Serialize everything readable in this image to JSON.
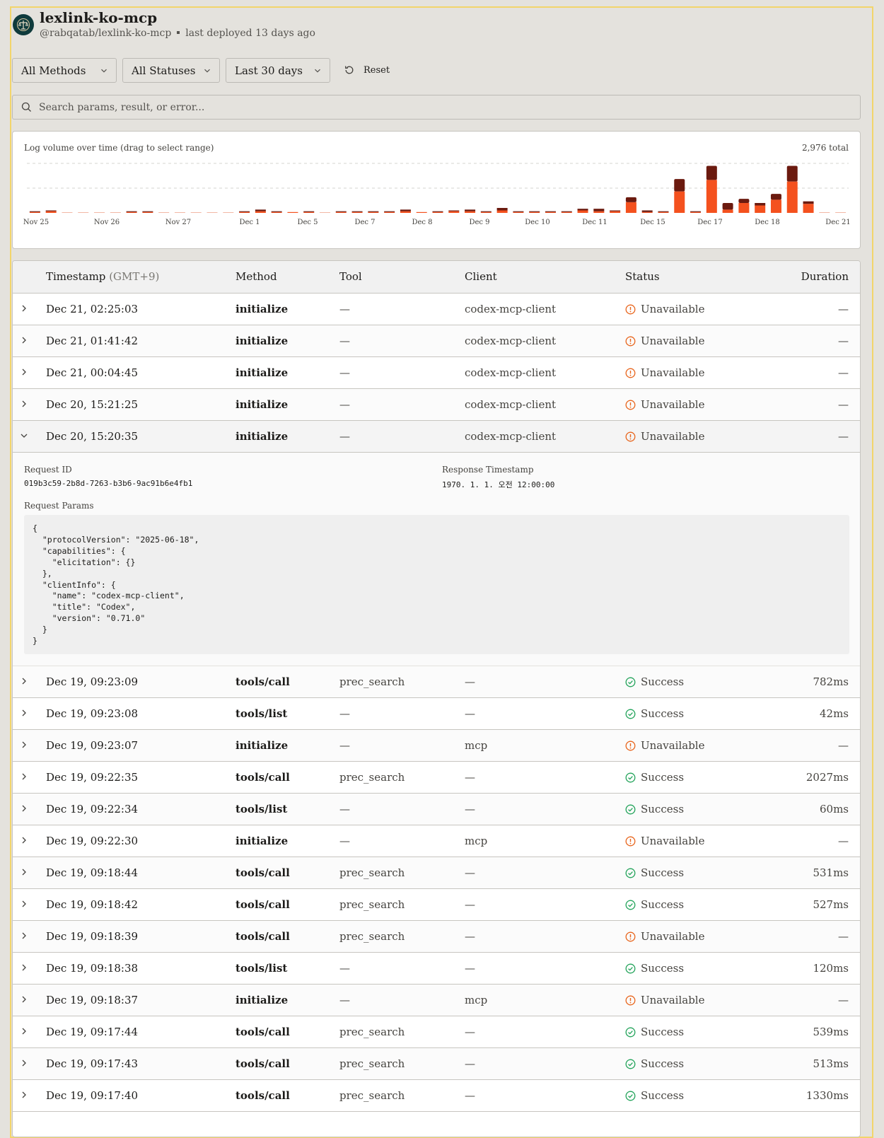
{
  "header": {
    "title": "lexlink-ko-mcp",
    "handle": "@rabqatab/lexlink-ko-mcp",
    "deployed": "last deployed 13 days ago"
  },
  "filters": {
    "methods": "All Methods",
    "statuses": "All Statuses",
    "range": "Last 30 days",
    "reset": "Reset"
  },
  "search": {
    "placeholder": "Search params, result, or error..."
  },
  "colors": {
    "success": "#22a35a",
    "warning": "#e8641b",
    "bar_primary": "#f4511e",
    "bar_dark": "#6b1a0f"
  },
  "chart": {
    "title": "Log volume over time (drag to select range)",
    "total": "2,976 total"
  },
  "chart_data": {
    "type": "bar",
    "stacked": true,
    "x_labels": [
      "Nov 25",
      "Nov 26",
      "Nov 27",
      "Dec 1",
      "Dec 5",
      "Dec 7",
      "Dec 8",
      "Dec 9",
      "Dec 10",
      "Dec 11",
      "Dec 15",
      "Dec 17",
      "Dec 18",
      "Dec 21"
    ],
    "series": [
      {
        "values": [
          1,
          2,
          0,
          0,
          0,
          0,
          1,
          1,
          0,
          0,
          0,
          0,
          0,
          1,
          2,
          1,
          1,
          1,
          0,
          1,
          1,
          1,
          1,
          2,
          1,
          1,
          2,
          2,
          1,
          3,
          1,
          1,
          1,
          1,
          3,
          2,
          2,
          13,
          1,
          1,
          26,
          1,
          40,
          4,
          12,
          9,
          16,
          38,
          11,
          0,
          0
        ]
      },
      {
        "values": [
          1,
          1,
          0,
          0,
          0,
          0,
          1,
          1,
          0,
          0,
          0,
          0,
          0,
          1,
          2,
          1,
          0,
          1,
          0,
          1,
          1,
          1,
          1,
          2,
          0,
          1,
          1,
          2,
          1,
          3,
          1,
          1,
          1,
          1,
          2,
          3,
          1,
          6,
          2,
          1,
          15,
          1,
          17,
          8,
          5,
          3,
          7,
          19,
          3,
          0,
          0
        ]
      }
    ],
    "ylim": [
      0,
      60
    ],
    "grid": true
  },
  "table": {
    "headers": {
      "timestamp": "Timestamp",
      "timezone": "(GMT+9)",
      "method": "Method",
      "tool": "Tool",
      "client": "Client",
      "status": "Status",
      "duration": "Duration"
    },
    "rows_top": [
      {
        "ts": "Dec 21, 02:25:03",
        "method": "initialize",
        "tool": "—",
        "client": "codex-mcp-client",
        "status": "Unavailable",
        "kind": "warn",
        "dur": "—"
      },
      {
        "ts": "Dec 21, 01:41:42",
        "method": "initialize",
        "tool": "—",
        "client": "codex-mcp-client",
        "status": "Unavailable",
        "kind": "warn",
        "dur": "—"
      },
      {
        "ts": "Dec 21, 00:04:45",
        "method": "initialize",
        "tool": "—",
        "client": "codex-mcp-client",
        "status": "Unavailable",
        "kind": "warn",
        "dur": "—"
      },
      {
        "ts": "Dec 20, 15:21:25",
        "method": "initialize",
        "tool": "—",
        "client": "codex-mcp-client",
        "status": "Unavailable",
        "kind": "warn",
        "dur": "—"
      },
      {
        "ts": "Dec 20, 15:20:35",
        "method": "initialize",
        "tool": "—",
        "client": "codex-mcp-client",
        "status": "Unavailable",
        "kind": "warn",
        "dur": "—",
        "open": true
      }
    ],
    "detail": {
      "request_id_label": "Request ID",
      "request_id": "019b3c59-2b8d-7263-b3b6-9ac91b6e4fb1",
      "response_ts_label": "Response Timestamp",
      "response_ts": "1970. 1. 1. 오전 12:00:00",
      "params_label": "Request Params",
      "params": "{\n  \"protocolVersion\": \"2025-06-18\",\n  \"capabilities\": {\n    \"elicitation\": {}\n  },\n  \"clientInfo\": {\n    \"name\": \"codex-mcp-client\",\n    \"title\": \"Codex\",\n    \"version\": \"0.71.0\"\n  }\n}"
    },
    "rows_bottom": [
      {
        "ts": "Dec 19, 09:23:09",
        "method": "tools/call",
        "tool": "prec_search",
        "client": "—",
        "status": "Success",
        "kind": "ok",
        "dur": "782ms"
      },
      {
        "ts": "Dec 19, 09:23:08",
        "method": "tools/list",
        "tool": "—",
        "client": "—",
        "status": "Success",
        "kind": "ok",
        "dur": "42ms"
      },
      {
        "ts": "Dec 19, 09:23:07",
        "method": "initialize",
        "tool": "—",
        "client": "mcp",
        "status": "Unavailable",
        "kind": "warn",
        "dur": "—"
      },
      {
        "ts": "Dec 19, 09:22:35",
        "method": "tools/call",
        "tool": "prec_search",
        "client": "—",
        "status": "Success",
        "kind": "ok",
        "dur": "2027ms"
      },
      {
        "ts": "Dec 19, 09:22:34",
        "method": "tools/list",
        "tool": "—",
        "client": "—",
        "status": "Success",
        "kind": "ok",
        "dur": "60ms"
      },
      {
        "ts": "Dec 19, 09:22:30",
        "method": "initialize",
        "tool": "—",
        "client": "mcp",
        "status": "Unavailable",
        "kind": "warn",
        "dur": "—"
      },
      {
        "ts": "Dec 19, 09:18:44",
        "method": "tools/call",
        "tool": "prec_search",
        "client": "—",
        "status": "Success",
        "kind": "ok",
        "dur": "531ms"
      },
      {
        "ts": "Dec 19, 09:18:42",
        "method": "tools/call",
        "tool": "prec_search",
        "client": "—",
        "status": "Success",
        "kind": "ok",
        "dur": "527ms"
      },
      {
        "ts": "Dec 19, 09:18:39",
        "method": "tools/call",
        "tool": "prec_search",
        "client": "—",
        "status": "Unavailable",
        "kind": "warn",
        "dur": "—"
      },
      {
        "ts": "Dec 19, 09:18:38",
        "method": "tools/list",
        "tool": "—",
        "client": "—",
        "status": "Success",
        "kind": "ok",
        "dur": "120ms"
      },
      {
        "ts": "Dec 19, 09:18:37",
        "method": "initialize",
        "tool": "—",
        "client": "mcp",
        "status": "Unavailable",
        "kind": "warn",
        "dur": "—"
      },
      {
        "ts": "Dec 19, 09:17:44",
        "method": "tools/call",
        "tool": "prec_search",
        "client": "—",
        "status": "Success",
        "kind": "ok",
        "dur": "539ms"
      },
      {
        "ts": "Dec 19, 09:17:43",
        "method": "tools/call",
        "tool": "prec_search",
        "client": "—",
        "status": "Success",
        "kind": "ok",
        "dur": "513ms"
      },
      {
        "ts": "Dec 19, 09:17:40",
        "method": "tools/call",
        "tool": "prec_search",
        "client": "—",
        "status": "Success",
        "kind": "ok",
        "dur": "1330ms"
      }
    ]
  }
}
